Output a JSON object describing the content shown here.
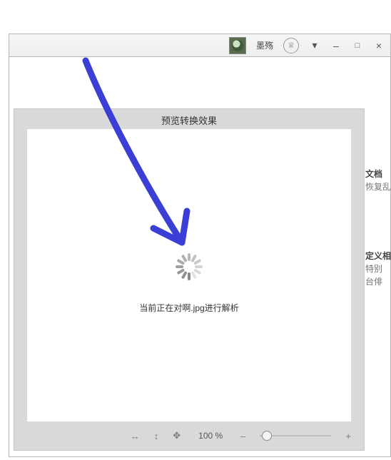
{
  "titlebar": {
    "username": "墨殇",
    "icons": {
      "crown": "♕",
      "dropdown": "▾",
      "minimize": "–",
      "maximize": "□",
      "close": "×"
    }
  },
  "panel": {
    "title": "预览转换效果",
    "status": "当前正在对啊.jpg进行解析"
  },
  "toolbar": {
    "pan_h": "↔",
    "pan_v": "↕",
    "move": "✥",
    "zoom_text": "100 %",
    "zoom_out": "–",
    "zoom_in": "+"
  },
  "side": {
    "line1_bold": "文档",
    "line1_rest": "恢复乱",
    "line2_bold": "定义相",
    "line2_rest1": "特别",
    "line2_rest2": "台俳"
  }
}
